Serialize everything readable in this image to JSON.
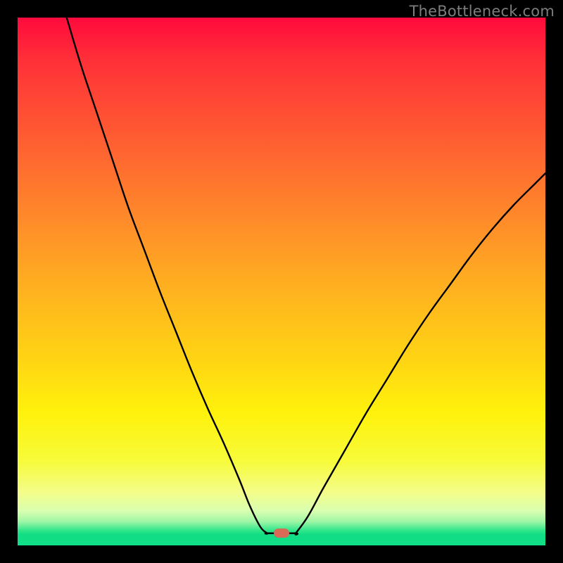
{
  "watermark": {
    "text": "TheBottleneck.com"
  },
  "marker_color": "#d86a57",
  "gradient": {
    "stops": [
      {
        "pct": 0,
        "color": "#ff0a3c"
      },
      {
        "pct": 8,
        "color": "#ff3038"
      },
      {
        "pct": 22,
        "color": "#ff5a32"
      },
      {
        "pct": 38,
        "color": "#ff8a2a"
      },
      {
        "pct": 52,
        "color": "#ffb31f"
      },
      {
        "pct": 65,
        "color": "#ffd513"
      },
      {
        "pct": 75,
        "color": "#fff20c"
      },
      {
        "pct": 84,
        "color": "#f7fb3a"
      },
      {
        "pct": 90,
        "color": "#f4fd8a"
      },
      {
        "pct": 93.5,
        "color": "#d9ffb0"
      },
      {
        "pct": 95.5,
        "color": "#9df6a6"
      },
      {
        "pct": 97.2,
        "color": "#2ee68a"
      },
      {
        "pct": 98,
        "color": "#11dd85"
      },
      {
        "pct": 100,
        "color": "#0fe088"
      }
    ]
  },
  "chart_data": {
    "type": "line",
    "title": "",
    "xlabel": "",
    "ylabel": "",
    "xlim": [
      0,
      100
    ],
    "ylim": [
      0,
      100
    ],
    "notes": "x and y are normalized to 0–100 of the visible plot area; y=0 is the bottom (green). The curve is a V-shaped bottleneck profile with its minimum near x≈50.",
    "series": [
      {
        "name": "left-branch",
        "x": [
          9.3,
          12,
          15,
          18,
          21,
          24,
          27,
          30,
          33,
          36,
          39,
          42,
          44,
          46,
          47.3
        ],
        "y": [
          100,
          91,
          82,
          73,
          64,
          56,
          48,
          40.5,
          33,
          26,
          19.5,
          12.5,
          7.5,
          3.5,
          2.3
        ]
      },
      {
        "name": "flat-bottom",
        "x": [
          47.3,
          52.7
        ],
        "y": [
          2.3,
          2.3
        ]
      },
      {
        "name": "right-branch",
        "x": [
          52.7,
          55,
          58,
          62,
          66,
          70,
          74,
          78,
          82,
          86,
          90,
          94,
          98,
          100
        ],
        "y": [
          2.3,
          5.5,
          11,
          18,
          25,
          31.5,
          38,
          44,
          49.5,
          55,
          60,
          64.5,
          68.5,
          70.5
        ]
      }
    ],
    "marker": {
      "x": 50,
      "y": 2.3,
      "shape": "rounded-rect",
      "color": "#d86a57"
    }
  }
}
